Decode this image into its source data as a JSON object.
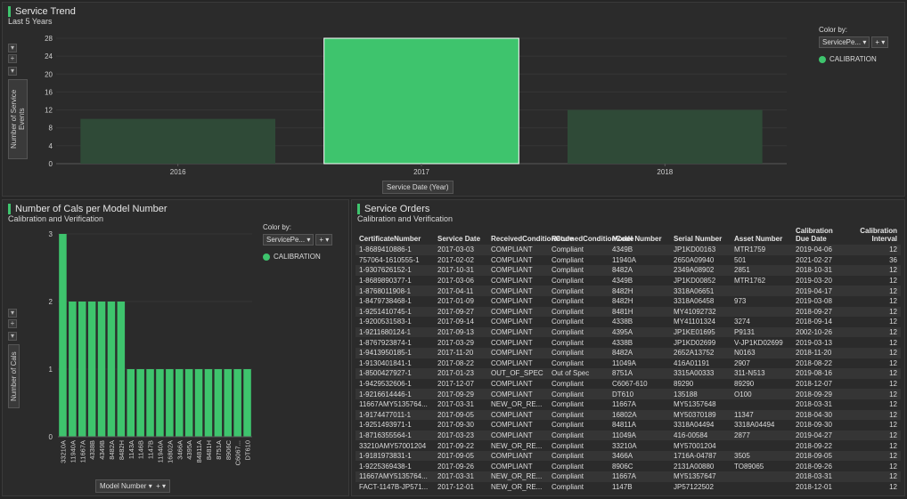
{
  "trend": {
    "title": "Service Trend",
    "subtitle": "Last 5 Years",
    "y_axis_title": "Number of Service Events",
    "x_axis_title": "Service Date (Year)",
    "color_by_label": "Color by:",
    "color_by_value": "ServicePe...",
    "legend_item": "CALIBRATION",
    "accent": "#3ec46d"
  },
  "cals": {
    "title": "Number of Cals per Model Number",
    "subtitle": "Calibration and Verification",
    "y_axis_title": "Number of Cals",
    "x_axis_title": "Model Number",
    "color_by_label": "Color by:",
    "color_by_value": "ServicePe...",
    "legend_item": "CALIBRATION"
  },
  "orders": {
    "title": "Service Orders",
    "subtitle": "Calibration and Verification",
    "columns": [
      "CertificateNumber",
      "Service Date",
      "ReceivedConditionCode",
      "ReturnedConditionCode",
      "Model Number",
      "Serial Number",
      "Asset Number",
      "Calibration Due Date",
      "Calibration Interval"
    ],
    "rows": [
      [
        "1-8689410886-1",
        "2017-03-03",
        "COMPLIANT",
        "Compliant",
        "4349B",
        "JP1KD00163",
        "MTR1759",
        "2019-04-06",
        "12"
      ],
      [
        "757064-1610555-1",
        "2017-02-02",
        "COMPLIANT",
        "Compliant",
        "11940A",
        "2650A09940",
        "501",
        "2021-02-27",
        "36"
      ],
      [
        "1-9307626152-1",
        "2017-10-31",
        "COMPLIANT",
        "Compliant",
        "8482A",
        "2349A08902",
        "2851",
        "2018-10-31",
        "12"
      ],
      [
        "1-8689890377-1",
        "2017-03-06",
        "COMPLIANT",
        "Compliant",
        "4349B",
        "JP1KD00852",
        "MTR1762",
        "2019-03-20",
        "12"
      ],
      [
        "1-8768011908-1",
        "2017-04-11",
        "COMPLIANT",
        "Compliant",
        "8482H",
        "3318A06651",
        "",
        "2019-04-17",
        "12"
      ],
      [
        "1-8479738468-1",
        "2017-01-09",
        "COMPLIANT",
        "Compliant",
        "8482H",
        "3318A06458",
        "973",
        "2019-03-08",
        "12"
      ],
      [
        "1-9251410745-1",
        "2017-09-27",
        "COMPLIANT",
        "Compliant",
        "8481H",
        "MY41092732",
        "",
        "2018-09-27",
        "12"
      ],
      [
        "1-9200531583-1",
        "2017-09-14",
        "COMPLIANT",
        "Compliant",
        "4338B",
        "MY41101324",
        "3274",
        "2018-09-14",
        "12"
      ],
      [
        "1-9211680124-1",
        "2017-09-13",
        "COMPLIANT",
        "Compliant",
        "4395A",
        "JP1KE01695",
        "P9131",
        "2002-10-26",
        "12"
      ],
      [
        "1-8767923874-1",
        "2017-03-29",
        "COMPLIANT",
        "Compliant",
        "4338B",
        "JP1KD02699",
        "V-JP1KD02699",
        "2019-03-13",
        "12"
      ],
      [
        "1-9413950185-1",
        "2017-11-20",
        "COMPLIANT",
        "Compliant",
        "8482A",
        "2652A13752",
        "N0163",
        "2018-11-20",
        "12"
      ],
      [
        "1-9130401841-1",
        "2017-08-22",
        "COMPLIANT",
        "Compliant",
        "11049A",
        "416A01191",
        "2907",
        "2018-08-22",
        "12"
      ],
      [
        "1-8500427927-1",
        "2017-01-23",
        "OUT_OF_SPEC",
        "Out of Spec",
        "8751A",
        "3315A00333",
        "311-N513",
        "2019-08-16",
        "12"
      ],
      [
        "1-9429532606-1",
        "2017-12-07",
        "COMPLIANT",
        "Compliant",
        "C6067-610",
        "89290",
        "89290",
        "2018-12-07",
        "12"
      ],
      [
        "1-9216614446-1",
        "2017-09-29",
        "COMPLIANT",
        "Compliant",
        "DT610",
        "135188",
        "O100",
        "2018-09-29",
        "12"
      ],
      [
        "11667AMY5135764...",
        "2017-03-31",
        "NEW_OR_RE...",
        "Compliant",
        "11667A",
        "MY51357648",
        "",
        "2018-03-31",
        "12"
      ],
      [
        "1-9174477011-1",
        "2017-09-05",
        "COMPLIANT",
        "Compliant",
        "16802A",
        "MY50370189",
        "11347",
        "2018-04-30",
        "12"
      ],
      [
        "1-9251493971-1",
        "2017-09-30",
        "COMPLIANT",
        "Compliant",
        "84811A",
        "3318A04494",
        "3318A04494",
        "2018-09-30",
        "12"
      ],
      [
        "1-8716355564-1",
        "2017-03-23",
        "COMPLIANT",
        "Compliant",
        "11049A",
        "416-00584",
        "2877",
        "2019-04-27",
        "12"
      ],
      [
        "33210AMY57001204",
        "2017-09-22",
        "NEW_OR_RE...",
        "Compliant",
        "33210A",
        "MY57001204",
        "",
        "2018-09-22",
        "12"
      ],
      [
        "1-9181973831-1",
        "2017-09-05",
        "COMPLIANT",
        "Compliant",
        "3466A",
        "1716A-04787",
        "3505",
        "2018-09-05",
        "12"
      ],
      [
        "1-9225369438-1",
        "2017-09-26",
        "COMPLIANT",
        "Compliant",
        "8906C",
        "2131A00880",
        "TO89065",
        "2018-09-26",
        "12"
      ],
      [
        "11667AMY5135764...",
        "2017-03-31",
        "NEW_OR_RE...",
        "Compliant",
        "11667A",
        "MY51357647",
        "",
        "2018-03-31",
        "12"
      ],
      [
        "FACT-1147B-JP571...",
        "2017-12-01",
        "NEW_OR_RE...",
        "Compliant",
        "1147B",
        "JP57122502",
        "",
        "2018-12-01",
        "12"
      ]
    ]
  },
  "chart_data": [
    {
      "type": "bar",
      "title": "Service Trend",
      "subtitle": "Last 5 Years",
      "categories": [
        "2016",
        "2017",
        "2018"
      ],
      "values": [
        10,
        28,
        12
      ],
      "highlighted": [
        false,
        true,
        false
      ],
      "xlabel": "Service Date (Year)",
      "ylabel": "Number of Service Events",
      "yticks": [
        0,
        4,
        8,
        12,
        16,
        20,
        24,
        28
      ],
      "ylim": [
        0,
        28
      ],
      "legend": [
        "CALIBRATION"
      ],
      "legend_position": "right",
      "colors": {
        "highlight": "#3ec46d",
        "dim": "#2f4a37"
      }
    },
    {
      "type": "bar",
      "title": "Number of Cals per Model Number",
      "subtitle": "Calibration and Verification",
      "categories": [
        "33210A",
        "11940A",
        "11667A",
        "4338B",
        "4349B",
        "8482A",
        "8482H",
        "1143A",
        "1146B",
        "1147B",
        "11940A",
        "16802A",
        "3466A",
        "4395A",
        "84811A",
        "8481H",
        "8751A",
        "8906C",
        "C6067...",
        "DT610"
      ],
      "values": [
        3,
        2,
        2,
        2,
        2,
        2,
        2,
        1,
        1,
        1,
        1,
        1,
        1,
        1,
        1,
        1,
        1,
        1,
        1,
        1
      ],
      "xlabel": "Model Number",
      "ylabel": "Number of Cals",
      "yticks": [
        0,
        1,
        2,
        3
      ],
      "ylim": [
        0,
        3
      ],
      "legend": [
        "CALIBRATION"
      ],
      "legend_position": "right",
      "colors": {
        "bar": "#3ec46d"
      }
    }
  ]
}
